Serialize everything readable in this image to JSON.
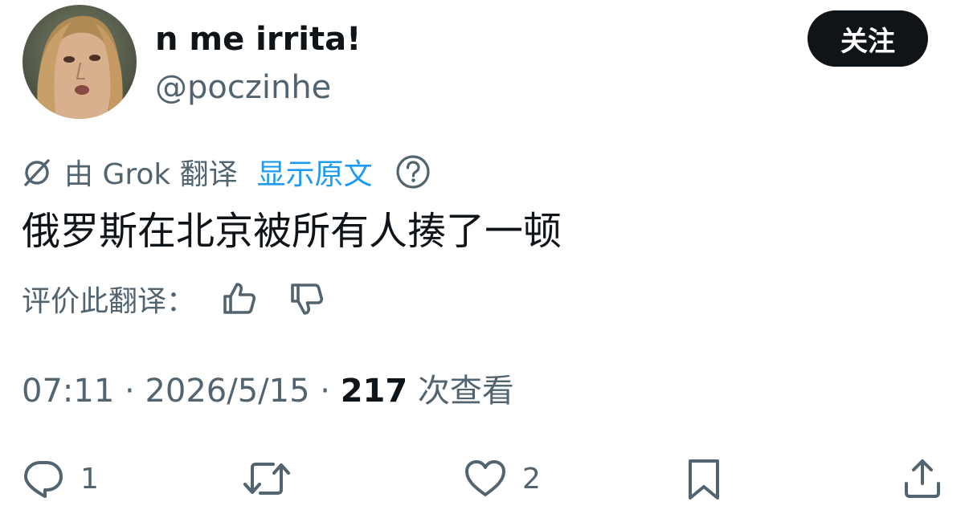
{
  "author": {
    "display_name": "n me irrita!",
    "handle": "@poczinhe",
    "avatar_icon": "profile-photo"
  },
  "follow_label": "关注",
  "translation": {
    "icon": "grok-icon",
    "by_label": "由 Grok 翻译",
    "show_original_label": "显示原文",
    "help_icon": "question-circle-icon"
  },
  "tweet_text": "俄罗斯在北京被所有人揍了一顿",
  "rate": {
    "label": "评价此翻译：",
    "up_icon": "thumbs-up-icon",
    "down_icon": "thumbs-down-icon"
  },
  "meta": {
    "time": "07:11",
    "separator": "·",
    "date": "2026/5/15",
    "views_count": "217",
    "views_label": "次查看"
  },
  "actions": {
    "reply_count": "1",
    "repost_count": "",
    "like_count": "2"
  },
  "colors": {
    "text": "#0f1419",
    "secondary": "#536471",
    "link": "#1d9bf0",
    "button_bg": "#0f1419"
  }
}
